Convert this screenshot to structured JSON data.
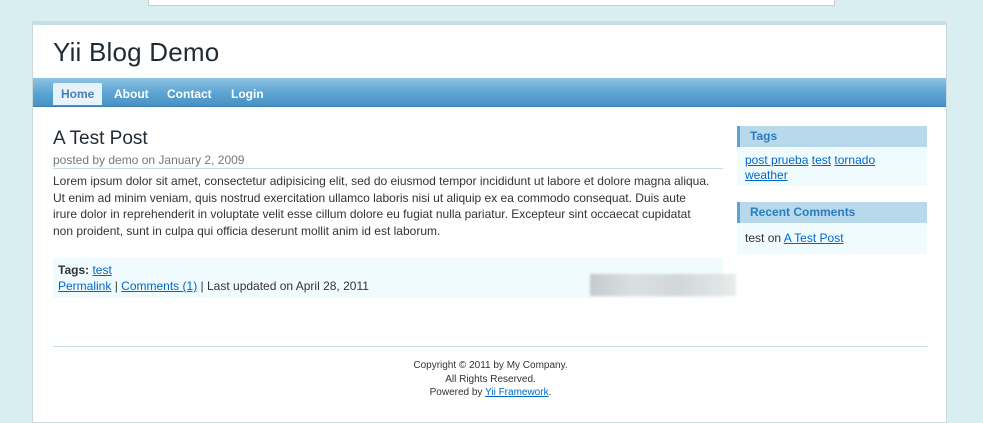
{
  "app": {
    "title": "Yii Blog Demo"
  },
  "menu": {
    "items": [
      {
        "label": "Home",
        "active": true
      },
      {
        "label": "About",
        "active": false
      },
      {
        "label": "Contact",
        "active": false
      },
      {
        "label": "Login",
        "active": false
      }
    ]
  },
  "post": {
    "title": "A Test Post",
    "author": "posted by demo on January 2, 2009",
    "content": "Lorem ipsum dolor sit amet, consectetur adipisicing elit, sed do eiusmod tempor incididunt ut labore et dolore magna aliqua. Ut enim ad minim veniam, quis nostrud exercitation ullamco laboris nisi ut aliquip ex ea commodo consequat. Duis aute irure dolor in reprehenderit in voluptate velit esse cillum dolore eu fugiat nulla pariatur. Excepteur sint occaecat cupidatat non proident, sunt in culpa qui officia deserunt mollit anim id est laborum.",
    "tags_label": "Tags:",
    "tags": [
      "test"
    ],
    "permalink_label": "Permalink",
    "comments_label": "Comments (1)",
    "separator": "|",
    "last_updated": "Last updated on April 28, 2011"
  },
  "sidebar": {
    "tags_title": "Tags",
    "tag_cloud": [
      "post prueba",
      "test",
      "tornado",
      "weather"
    ],
    "recent_comments_title": "Recent Comments",
    "recent_comment": {
      "author": "test",
      "on": "on",
      "post": "A Test Post"
    }
  },
  "footer": {
    "copyright": "Copyright © 2011 by My Company.",
    "rights": "All Rights Reserved.",
    "powered_prefix": "Powered by",
    "powered_link": "Yii Framework",
    "powered_suffix": "."
  },
  "colors": {
    "background": "#d8eef0",
    "menu_bar": "#5aa3d2",
    "link": "#0066cc",
    "portlet_header": "#b8d9ec"
  }
}
